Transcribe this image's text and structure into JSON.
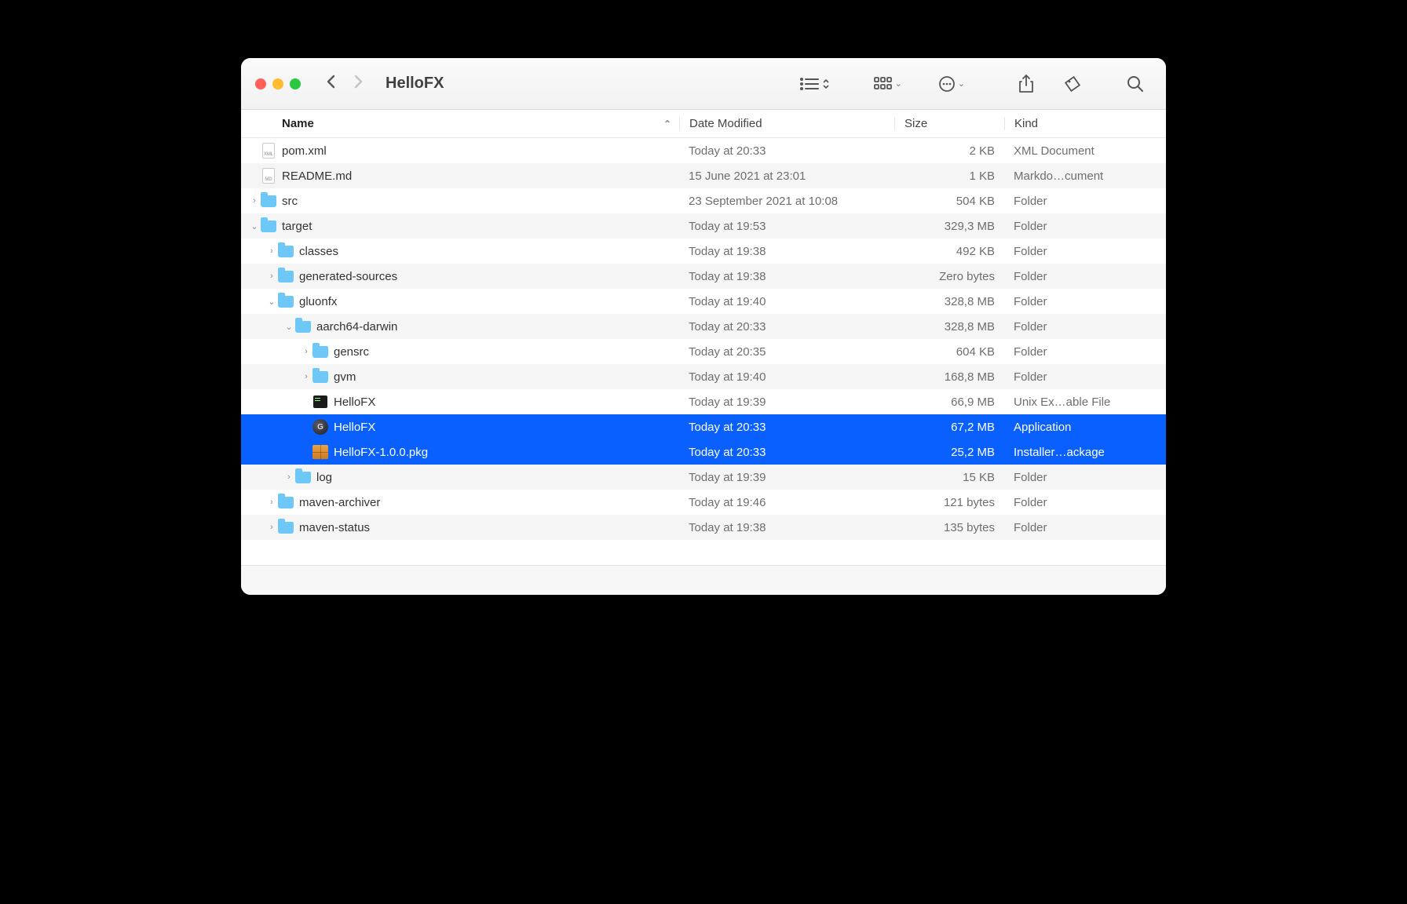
{
  "window": {
    "title": "HelloFX"
  },
  "columns": {
    "name": "Name",
    "date": "Date Modified",
    "size": "Size",
    "kind": "Kind"
  },
  "rows": [
    {
      "indent": 0,
      "disc": "",
      "icon": "doc",
      "ft": "XML",
      "name": "pom.xml",
      "date": "Today at 20:33",
      "size": "2 KB",
      "kind": "XML Document",
      "alt": false,
      "sel": false
    },
    {
      "indent": 0,
      "disc": "",
      "icon": "doc",
      "ft": "MD",
      "name": "README.md",
      "date": "15 June 2021 at 23:01",
      "size": "1 KB",
      "kind": "Markdo…cument",
      "alt": true,
      "sel": false
    },
    {
      "indent": 0,
      "disc": ">",
      "icon": "folder",
      "name": "src",
      "date": "23 September 2021 at 10:08",
      "size": "504 KB",
      "kind": "Folder",
      "alt": false,
      "sel": false
    },
    {
      "indent": 0,
      "disc": "v",
      "icon": "folder",
      "name": "target",
      "date": "Today at 19:53",
      "size": "329,3 MB",
      "kind": "Folder",
      "alt": true,
      "sel": false
    },
    {
      "indent": 1,
      "disc": ">",
      "icon": "folder",
      "name": "classes",
      "date": "Today at 19:38",
      "size": "492 KB",
      "kind": "Folder",
      "alt": false,
      "sel": false
    },
    {
      "indent": 1,
      "disc": ">",
      "icon": "folder",
      "name": "generated-sources",
      "date": "Today at 19:38",
      "size": "Zero bytes",
      "kind": "Folder",
      "alt": true,
      "sel": false
    },
    {
      "indent": 1,
      "disc": "v",
      "icon": "folder",
      "name": "gluonfx",
      "date": "Today at 19:40",
      "size": "328,8 MB",
      "kind": "Folder",
      "alt": false,
      "sel": false
    },
    {
      "indent": 2,
      "disc": "v",
      "icon": "folder",
      "name": "aarch64-darwin",
      "date": "Today at 20:33",
      "size": "328,8 MB",
      "kind": "Folder",
      "alt": true,
      "sel": false
    },
    {
      "indent": 3,
      "disc": ">",
      "icon": "folder",
      "name": "gensrc",
      "date": "Today at 20:35",
      "size": "604 KB",
      "kind": "Folder",
      "alt": false,
      "sel": false
    },
    {
      "indent": 3,
      "disc": ">",
      "icon": "folder",
      "name": "gvm",
      "date": "Today at 19:40",
      "size": "168,8 MB",
      "kind": "Folder",
      "alt": true,
      "sel": false
    },
    {
      "indent": 3,
      "disc": "",
      "icon": "exec",
      "name": "HelloFX",
      "date": "Today at 19:39",
      "size": "66,9 MB",
      "kind": "Unix Ex…able File",
      "alt": false,
      "sel": false
    },
    {
      "indent": 3,
      "disc": "",
      "icon": "app",
      "name": "HelloFX",
      "date": "Today at 20:33",
      "size": "67,2 MB",
      "kind": "Application",
      "alt": true,
      "sel": true
    },
    {
      "indent": 3,
      "disc": "",
      "icon": "pkg",
      "name": "HelloFX-1.0.0.pkg",
      "date": "Today at 20:33",
      "size": "25,2 MB",
      "kind": "Installer…ackage",
      "alt": false,
      "sel": true
    },
    {
      "indent": 2,
      "disc": ">",
      "icon": "folder",
      "name": "log",
      "date": "Today at 19:39",
      "size": "15 KB",
      "kind": "Folder",
      "alt": true,
      "sel": false
    },
    {
      "indent": 1,
      "disc": ">",
      "icon": "folder",
      "name": "maven-archiver",
      "date": "Today at 19:46",
      "size": "121 bytes",
      "kind": "Folder",
      "alt": false,
      "sel": false
    },
    {
      "indent": 1,
      "disc": ">",
      "icon": "folder",
      "name": "maven-status",
      "date": "Today at 19:38",
      "size": "135 bytes",
      "kind": "Folder",
      "alt": true,
      "sel": false
    }
  ]
}
